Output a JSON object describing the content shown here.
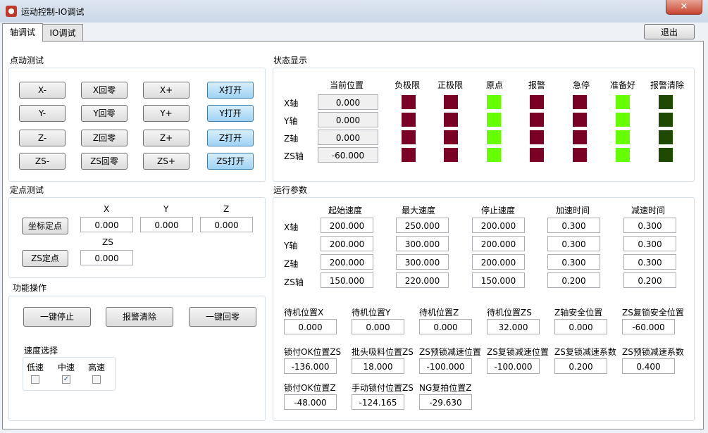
{
  "window": {
    "title": "运动控制-IO调试",
    "close_glyph": "✕"
  },
  "tabs": [
    "轴调试",
    "IO调试"
  ],
  "exit_label": "退出",
  "jog": {
    "title": "点动测试",
    "rows": [
      [
        "X-",
        "X回零",
        "X+",
        "X打开"
      ],
      [
        "Y-",
        "Y回零",
        "Y+",
        "Y打开"
      ],
      [
        "Z-",
        "Z回零",
        "Z+",
        "Z打开"
      ],
      [
        "ZS-",
        "ZS回零",
        "ZS+",
        "ZS打开"
      ]
    ]
  },
  "status": {
    "title": "状态显示",
    "headers": [
      "当前位置",
      "负极限",
      "正极限",
      "原点",
      "报警",
      "急停",
      "准备好",
      "报警清除"
    ],
    "axes": [
      "X轴",
      "Y轴",
      "Z轴",
      "ZS轴"
    ],
    "positions": [
      "0.000",
      "0.000",
      "0.000",
      "-60.000"
    ],
    "colors": {
      "off": "#7a0026",
      "on": "#66ff00",
      "dark": "#1e4a00"
    },
    "indicators": [
      [
        "off",
        "off",
        "on",
        "off",
        "off",
        "on",
        "dark"
      ],
      [
        "off",
        "off",
        "on",
        "off",
        "off",
        "on",
        "dark"
      ],
      [
        "off",
        "off",
        "on",
        "off",
        "off",
        "on",
        "dark"
      ],
      [
        "off",
        "off",
        "on",
        "off",
        "off",
        "on",
        "dark"
      ]
    ]
  },
  "fixed": {
    "title": "定点测试",
    "labels": {
      "x": "X",
      "y": "Y",
      "z": "Z",
      "zs": "ZS"
    },
    "coord_button": "坐标定点",
    "zs_button": "ZS定点",
    "values": {
      "x": "0.000",
      "y": "0.000",
      "z": "0.000",
      "zs": "0.000"
    }
  },
  "func": {
    "title": "功能操作",
    "buttons": [
      "一键停止",
      "报警清除",
      "一键回零"
    ],
    "speed_title": "速度选择",
    "speeds": [
      {
        "label": "低速",
        "checked": false
      },
      {
        "label": "中速",
        "checked": true
      },
      {
        "label": "高速",
        "checked": false
      }
    ],
    "check_glyph": "✓"
  },
  "params": {
    "title": "运行参数",
    "headers": [
      "起始速度",
      "最大速度",
      "停止速度",
      "加速时间",
      "减速时间"
    ],
    "axes": [
      "X轴",
      "Y轴",
      "Z轴",
      "ZS轴"
    ],
    "values": [
      [
        "200.000",
        "250.000",
        "200.000",
        "0.300",
        "0.300"
      ],
      [
        "200.000",
        "300.000",
        "200.000",
        "0.300",
        "0.300"
      ],
      [
        "200.000",
        "300.000",
        "200.000",
        "0.300",
        "0.300"
      ],
      [
        "150.000",
        "220.000",
        "150.000",
        "0.200",
        "0.200"
      ]
    ],
    "extra": [
      [
        {
          "label": "待机位置X",
          "value": "0.000"
        },
        {
          "label": "待机位置Y",
          "value": "0.000"
        },
        {
          "label": "待机位置Z",
          "value": "0.000"
        },
        {
          "label": "待机位置ZS",
          "value": "32.000"
        },
        {
          "label": "Z轴安全位置",
          "value": "0.000"
        },
        {
          "label": "ZS复锁安全位置",
          "value": "-60.000"
        }
      ],
      [
        {
          "label": "锁付OK位置ZS",
          "value": "-136.000"
        },
        {
          "label": "批头吸料位置ZS",
          "value": "18.000"
        },
        {
          "label": "ZS预锁减速位置",
          "value": "-100.000"
        },
        {
          "label": "ZS复锁减速位置",
          "value": "-100.000"
        },
        {
          "label": "ZS复锁减速系数",
          "value": "0.200"
        },
        {
          "label": "ZS预锁减速系数",
          "value": "0.400"
        }
      ],
      [
        {
          "label": "锁付OK位置Z",
          "value": "-48.000"
        },
        {
          "label": "手动锁付位置ZS",
          "value": "-124.165"
        },
        {
          "label": "NG复拍位置Z",
          "value": "-29.630"
        }
      ]
    ]
  }
}
